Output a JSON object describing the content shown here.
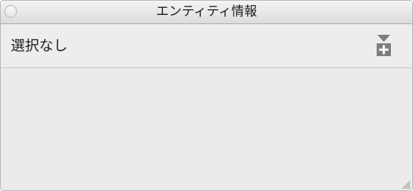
{
  "window": {
    "title": "エンティティ情報"
  },
  "selector": {
    "selection_text": "選択なし",
    "menu_icon": "dropdown-add-icon"
  },
  "colors": {
    "window_bg": "#ececec",
    "icon_gray": "#7d7d7d"
  }
}
